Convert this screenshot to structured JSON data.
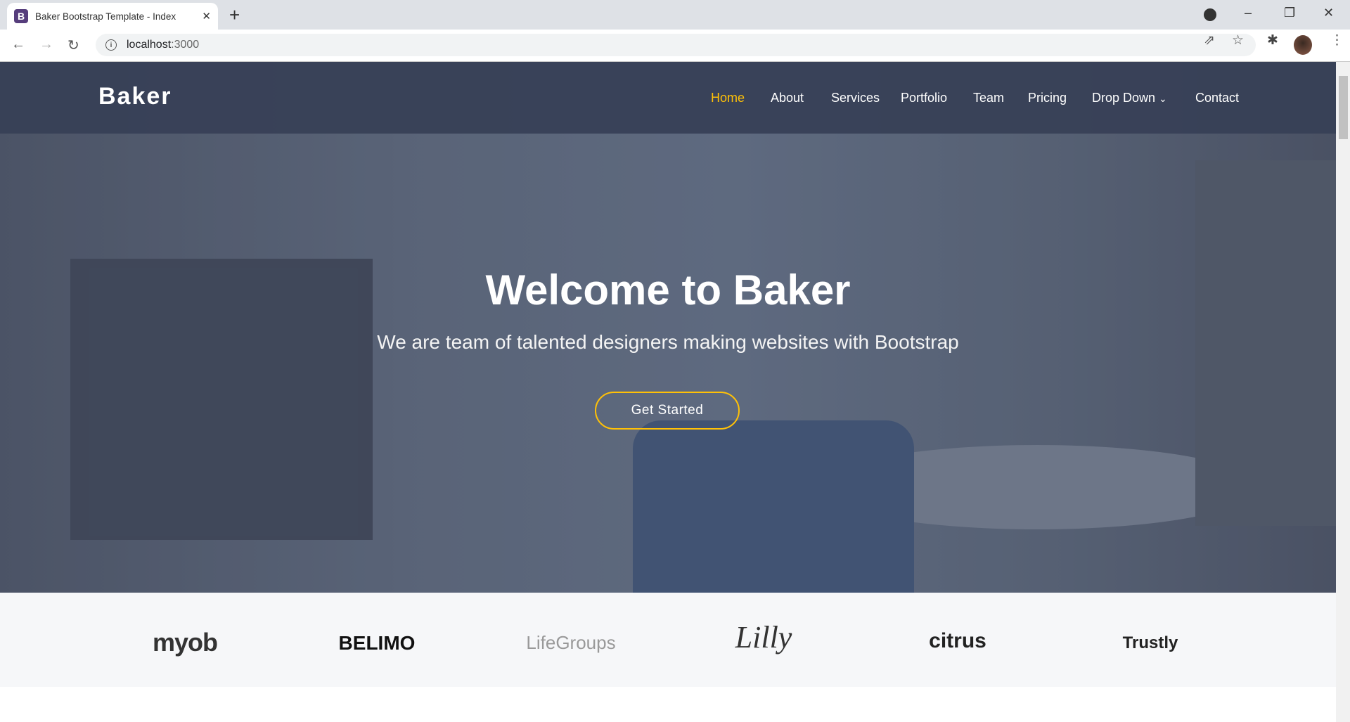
{
  "browser": {
    "tab_title": "Baker Bootstrap Template - Index",
    "favicon": "B",
    "url_host": "localhost",
    "url_port": ":3000"
  },
  "site": {
    "logo": "Baker",
    "nav": [
      {
        "label": "Home",
        "active": true
      },
      {
        "label": "About"
      },
      {
        "label": "Services"
      },
      {
        "label": "Portfolio"
      },
      {
        "label": "Team"
      },
      {
        "label": "Pricing"
      },
      {
        "label": "Drop Down"
      },
      {
        "label": "Contact"
      }
    ],
    "hero": {
      "title": "Welcome to Baker",
      "subtitle": "We are team of talented designers making websites with Bootstrap",
      "cta": "Get Started"
    },
    "clients": [
      "myob",
      "BELIMO",
      "LifeGroups",
      "Lilly",
      "citrus",
      "Trustly"
    ],
    "accent": "#ffc107"
  }
}
